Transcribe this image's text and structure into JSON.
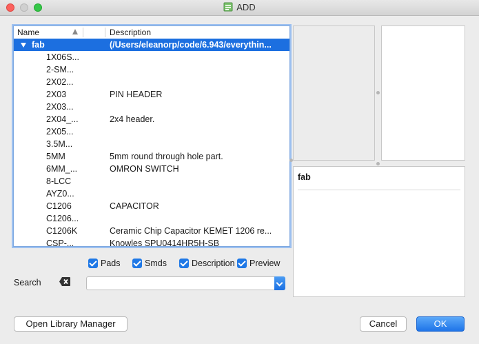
{
  "window": {
    "title": "ADD",
    "app_icon": "eagle-app-icon"
  },
  "tree": {
    "columns": {
      "name": "Name",
      "description": "Description"
    },
    "selected": {
      "name": "fab",
      "description": "(/Users/eleanorp/code/6.943/everythin..."
    },
    "items": [
      {
        "name": "1X06S...",
        "description": ""
      },
      {
        "name": "2-SM...",
        "description": ""
      },
      {
        "name": "2X02...",
        "description": ""
      },
      {
        "name": "2X03",
        "description": "PIN HEADER"
      },
      {
        "name": "2X03...",
        "description": ""
      },
      {
        "name": "2X04_...",
        "description": "2x4 header."
      },
      {
        "name": "2X05...",
        "description": ""
      },
      {
        "name": "3.5M...",
        "description": ""
      },
      {
        "name": "5MM",
        "description": "5mm round through hole part."
      },
      {
        "name": "6MM_...",
        "description": "OMRON SWITCH"
      },
      {
        "name": "8-LCC",
        "description": ""
      },
      {
        "name": "AYZ0...",
        "description": ""
      },
      {
        "name": "C1206",
        "description": "CAPACITOR"
      },
      {
        "name": "C1206...",
        "description": ""
      },
      {
        "name": "C1206K",
        "description": "Ceramic Chip Capacitor KEMET 1206 re..."
      },
      {
        "name": "CSP-...",
        "description": "Knowles SPU0414HR5H-SB"
      }
    ]
  },
  "description_pane": {
    "title": "fab"
  },
  "filters": [
    {
      "label": "Pads",
      "checked": true
    },
    {
      "label": "Smds",
      "checked": true
    },
    {
      "label": "Description",
      "checked": true
    },
    {
      "label": "Preview",
      "checked": true
    }
  ],
  "search": {
    "label": "Search",
    "value": "",
    "placeholder": ""
  },
  "buttons": {
    "open_library_manager": "Open Library Manager",
    "cancel": "Cancel",
    "ok": "OK"
  },
  "colors": {
    "selection": "#1c6fe0",
    "accent": "#1f78e6"
  }
}
